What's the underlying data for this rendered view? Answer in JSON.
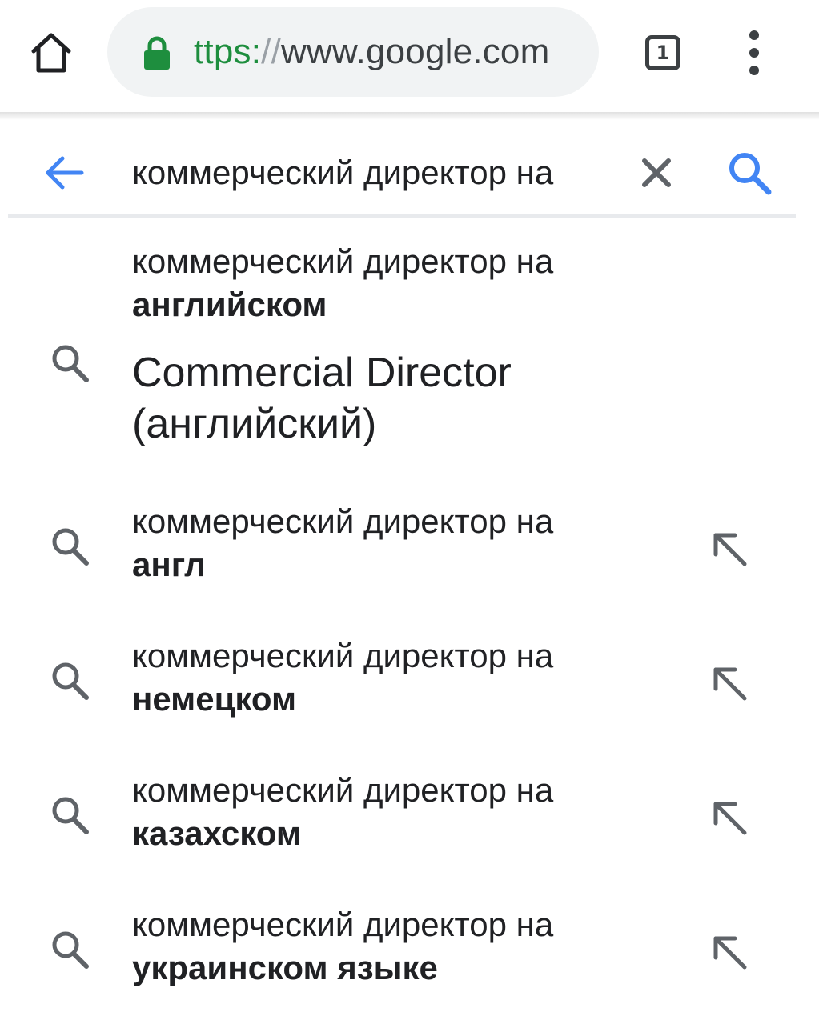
{
  "browser": {
    "url_scheme": "ttps:",
    "url_sep": "//",
    "url_host": "www.google.com",
    "tab_count": "1",
    "accent_color": "#1e8e3e"
  },
  "search": {
    "query": "коммерческий директор на",
    "back_icon": "arrow-left-icon",
    "clear_icon": "close-icon",
    "search_icon": "search-icon",
    "accent_color": "#4285f4"
  },
  "suggestions": [
    {
      "query": "коммерческий директор на",
      "completion": "английском",
      "answer": "Commercial Director (английский)"
    },
    {
      "query": "коммерческий директор на",
      "completion": "англ"
    },
    {
      "query": "коммерческий директор на",
      "completion": "немецком"
    },
    {
      "query": "коммерческий директор на",
      "completion": "казахском"
    },
    {
      "query": "коммерческий директор на",
      "completion": "украинском языке"
    }
  ]
}
